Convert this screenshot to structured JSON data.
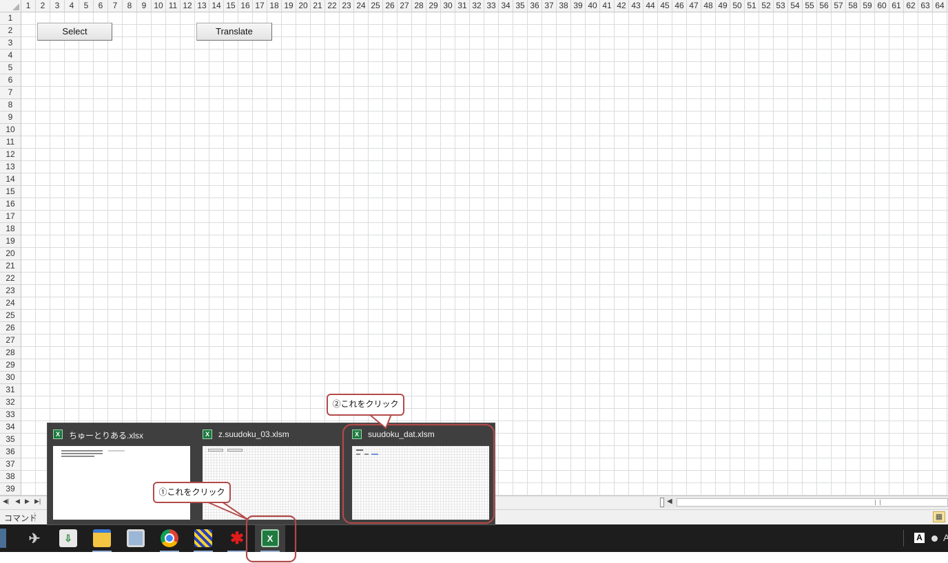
{
  "sheet": {
    "columns": [
      "1",
      "2",
      "3",
      "4",
      "5",
      "6",
      "7",
      "8",
      "9",
      "10",
      "11",
      "12",
      "13",
      "14",
      "15",
      "16",
      "17",
      "18",
      "19",
      "20",
      "21",
      "22",
      "23",
      "24",
      "25",
      "26",
      "27",
      "28",
      "29",
      "30",
      "31",
      "32",
      "33",
      "34",
      "35",
      "36",
      "37",
      "38",
      "39",
      "40",
      "41",
      "42",
      "43",
      "44",
      "45",
      "46",
      "47",
      "48",
      "49",
      "50",
      "51",
      "52",
      "53",
      "54",
      "55",
      "56",
      "57",
      "58",
      "59",
      "60",
      "61",
      "62",
      "63",
      "64"
    ],
    "rows": [
      "1",
      "2",
      "3",
      "4",
      "5",
      "6",
      "7",
      "8",
      "9",
      "10",
      "11",
      "12",
      "13",
      "14",
      "15",
      "16",
      "17",
      "18",
      "19",
      "20",
      "21",
      "22",
      "23",
      "24",
      "25",
      "26",
      "27",
      "28",
      "29",
      "30",
      "31",
      "32",
      "33",
      "34",
      "35",
      "36",
      "37",
      "38",
      "39"
    ],
    "buttons": {
      "select_label": "Select",
      "translate_label": "Translate"
    }
  },
  "statusbar": {
    "mode": "コマンド"
  },
  "preview": {
    "windows": [
      {
        "title": "ちゅーとりある.xlsx"
      },
      {
        "title": "z.suudoku_03.xlsm"
      },
      {
        "title": "suudoku_dat.xlsm"
      }
    ]
  },
  "annotations": {
    "step1": "①これをクリック",
    "step2": "②これをクリック"
  },
  "taskbar": {
    "icons": [
      "paper-plane-icon",
      "folder-download-icon",
      "file-explorer-icon",
      "monitor-icon",
      "chrome-icon",
      "sudoku-app-icon",
      "red-splash-icon",
      "excel-icon"
    ],
    "tray_label": "A"
  },
  "colors": {
    "annotation": "#b24a4a",
    "taskbar": "#1d1d1d",
    "preview_bg": "#3f3f3f"
  }
}
